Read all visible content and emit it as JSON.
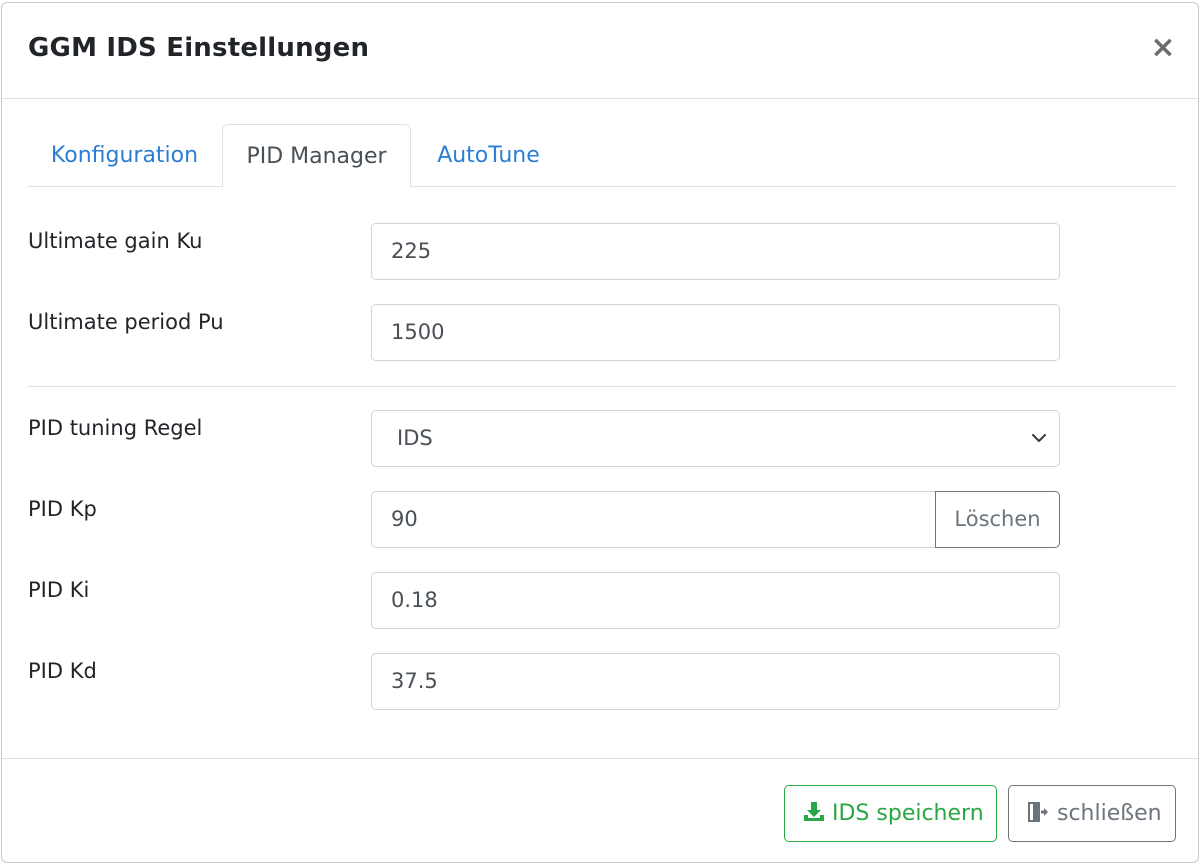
{
  "modal": {
    "title": "GGM IDS Einstellungen",
    "close_symbol": "×"
  },
  "tabs": [
    {
      "label": "Konfiguration",
      "active": false
    },
    {
      "label": "PID Manager",
      "active": true
    },
    {
      "label": "AutoTune",
      "active": false
    }
  ],
  "fields": {
    "ultimate_gain": {
      "label": "Ultimate gain Ku",
      "value": "225"
    },
    "ultimate_period": {
      "label": "Ultimate period Pu",
      "value": "1500"
    },
    "tuning_rule": {
      "label": "PID tuning Regel",
      "value": "IDS"
    },
    "kp": {
      "label": "PID Kp",
      "value": "90",
      "clear_label": "Löschen"
    },
    "ki": {
      "label": "PID Ki",
      "value": "0.18"
    },
    "kd": {
      "label": "PID Kd",
      "value": "37.5"
    }
  },
  "footer": {
    "save_label": "IDS speichern",
    "close_label": "schließen"
  },
  "colors": {
    "link": "#2a7fd4",
    "success": "#28a745",
    "secondary": "#6c757d",
    "border": "#dee2e6"
  },
  "icons": {
    "close": "close-icon",
    "chevron": "chevron-down-icon",
    "save": "download-icon",
    "exit": "sign-out-icon"
  }
}
